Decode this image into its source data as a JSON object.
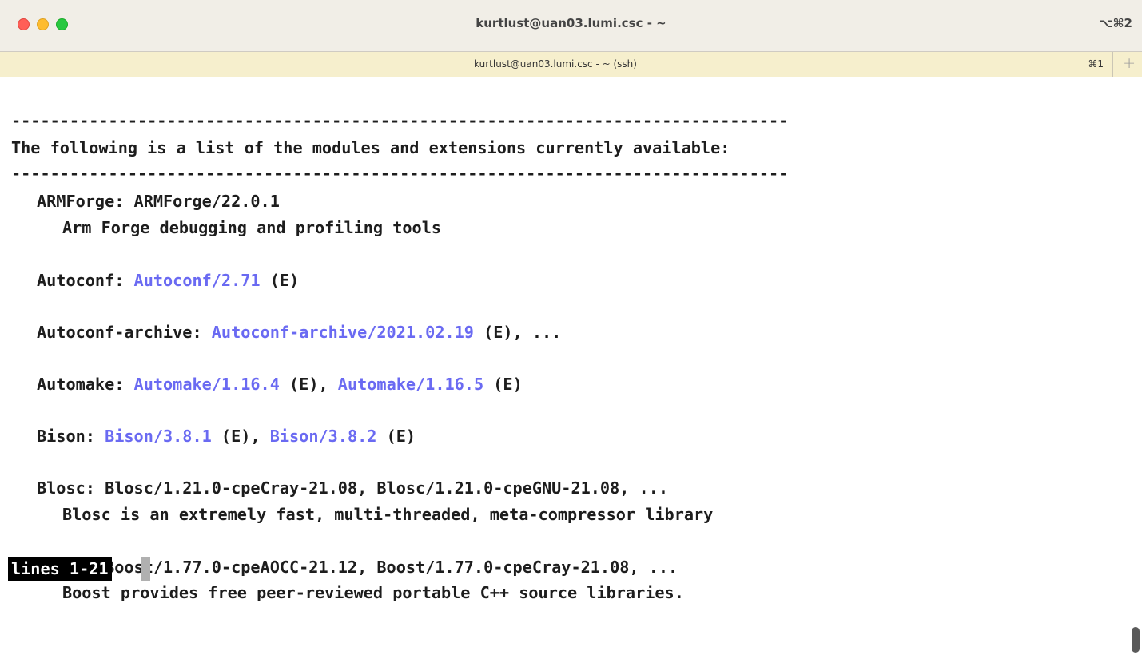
{
  "window": {
    "title": "kurtlust@uan03.lumi.csc - ~",
    "shortcut": "⌥⌘2"
  },
  "tab": {
    "title": "kurtlust@uan03.lumi.csc - ~ (ssh)",
    "shortcut": "⌘1",
    "new_tab_label": "+"
  },
  "terminal": {
    "separator": "--------------------------------------------------------------------------------",
    "header": "The following is a list of the modules and extensions currently available:",
    "armforge": {
      "name": "ARMForge: ",
      "version": "ARMForge/22.0.1",
      "desc": "Arm Forge debugging and profiling tools"
    },
    "autoconf": {
      "name": "Autoconf: ",
      "v1": "Autoconf/2.71",
      "tail": " (E)"
    },
    "autoconf_archive": {
      "name": "Autoconf-archive: ",
      "v1": "Autoconf-archive/2021.02.19",
      "tail": " (E), ..."
    },
    "automake": {
      "name": "Automake: ",
      "v1": "Automake/1.16.4",
      "mid": " (E), ",
      "v2": "Automake/1.16.5",
      "tail": " (E)"
    },
    "bison": {
      "name": "Bison: ",
      "v1": "Bison/3.8.1",
      "mid": " (E), ",
      "v2": "Bison/3.8.2",
      "tail": " (E)"
    },
    "blosc": {
      "line": "Blosc: Blosc/1.21.0-cpeCray-21.08, Blosc/1.21.0-cpeGNU-21.08, ...",
      "desc": "Blosc is an extremely fast, multi-threaded, meta-compressor library"
    },
    "boost": {
      "line": "Boost: Boost/1.77.0-cpeAOCC-21.12, Boost/1.77.0-cpeCray-21.08, ...",
      "desc": "Boost provides free peer-reviewed portable C++ source libraries."
    },
    "status": "lines 1-21"
  },
  "colors": {
    "link": "#6a6af2",
    "tabbar": "#f6efcd",
    "titlebar": "#f1eee7"
  },
  "icons": [
    "close-button",
    "minimize-button",
    "zoom-button",
    "new-tab-icon"
  ]
}
